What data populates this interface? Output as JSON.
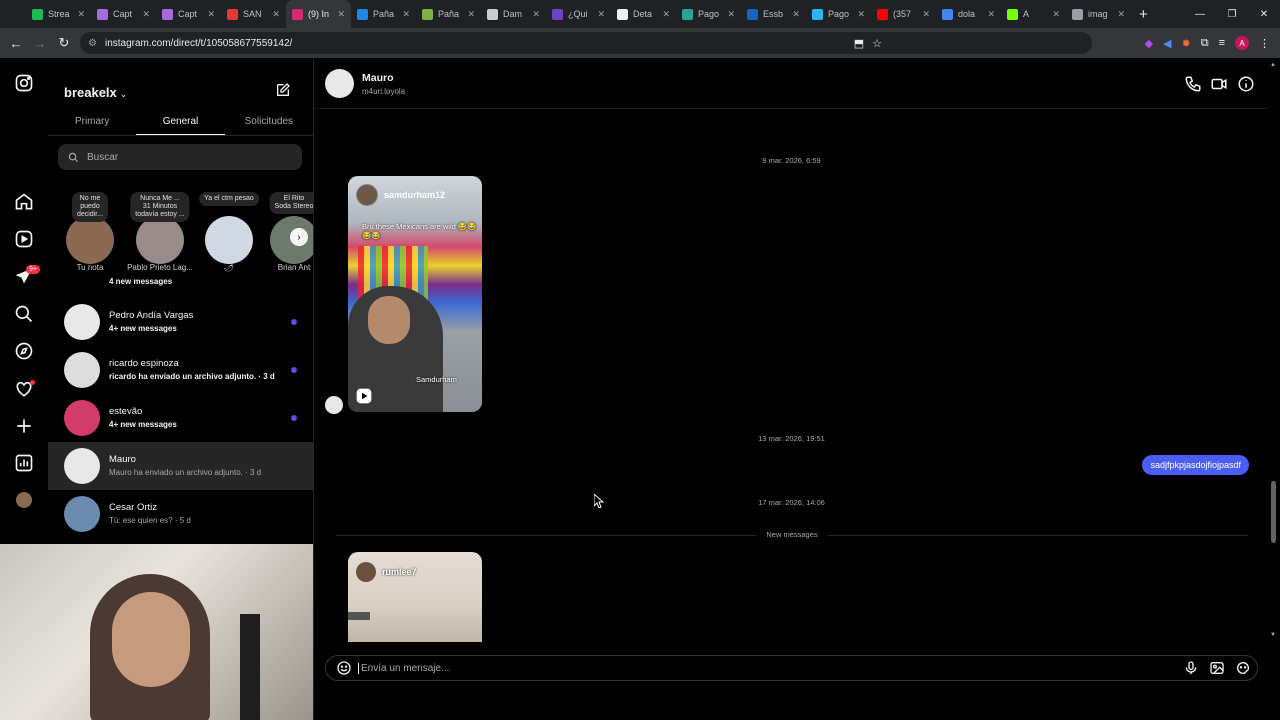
{
  "browser": {
    "tabs": [
      {
        "title": "Strea",
        "color": "#1db954"
      },
      {
        "title": "Capt",
        "color": "#a56bdc"
      },
      {
        "title": "Capt",
        "color": "#a56bdc"
      },
      {
        "title": "SAN",
        "color": "#e53935"
      },
      {
        "title": "(9) In",
        "color": "#d62976"
      },
      {
        "title": "Paña",
        "color": "#1e88e5"
      },
      {
        "title": "Paña",
        "color": "#7cb342"
      },
      {
        "title": "Dam",
        "color": "#cccccc"
      },
      {
        "title": "¿Qui",
        "color": "#6f42c1"
      },
      {
        "title": "Deta",
        "color": "#eeeeee"
      },
      {
        "title": "Pago",
        "color": "#26a69a"
      },
      {
        "title": "Essb",
        "color": "#1565c0"
      },
      {
        "title": "Pago",
        "color": "#29b6f6"
      },
      {
        "title": "(357",
        "color": "#ff0000"
      },
      {
        "title": "dola",
        "color": "#4285f4"
      },
      {
        "title": "A",
        "color": "#76ff03"
      },
      {
        "title": "imag",
        "color": "#9aa0a6"
      }
    ],
    "url": "instagram.com/direct/t/105058677559142/",
    "profile_initial": "A"
  },
  "sidebar": {
    "username": "breakelx",
    "tabs": [
      "Primary",
      "General",
      "Solicitudes"
    ],
    "selected_tab": "General",
    "search_placeholder": "Buscar",
    "notification_badge": "9+",
    "notes": [
      {
        "bubble": "No me\npuedo\ndecidir...",
        "label": "Tu nota",
        "avatar": "#8a6a55"
      },
      {
        "bubble": "Nunca Me ...\n31 Minutos\ntodavía estoy ...",
        "label": "Pablo Prieto Lag...",
        "avatar": "#9a8a8a"
      },
      {
        "bubble": "Ya el ctm pesao",
        "label": "🌶",
        "avatar": "#cfd8e3"
      },
      {
        "bubble": "El Rito\nSoda Stereo",
        "label": "Brian Ant",
        "avatar": "#6b7a6a"
      }
    ],
    "conversations": [
      {
        "name": "",
        "sub": "4 new messages",
        "bold": true,
        "unread": false
      },
      {
        "name": "Pedro Andía Vargas",
        "sub": "4+ new messages",
        "bold": true,
        "unread": true
      },
      {
        "name": "ricardo espinoza",
        "sub": "ricardo ha enviado un archivo adjunto. · 3 d",
        "bold": true,
        "unread": true
      },
      {
        "name": "estevão",
        "sub": "4+ new messages",
        "bold": true,
        "unread": true
      },
      {
        "name": "Mauro",
        "sub": "Mauro ha enviado un archivo adjunto. · 3 d",
        "bold": false,
        "unread": false
      },
      {
        "name": "Cesar Ortiz",
        "sub": "Tú: ese quien es? · 5 d",
        "bold": false,
        "unread": false
      }
    ]
  },
  "chat": {
    "name": "Mauro",
    "handle": "m4uri.loyola",
    "timestamps": [
      "9 mar. 2026, 6:59",
      "13 mar. 2026, 19:51",
      "17 mar. 2026, 14:06"
    ],
    "reel1": {
      "user": "samdurham12",
      "caption": "Bru these Mexicans are wild 😂😂😂😂",
      "watermark": "Samdurham"
    },
    "my_message": "sadjfpkpjasdojfiojpasdf",
    "new_messages_label": "New messages",
    "reel2": {
      "user": "rumlee7"
    },
    "composer_placeholder": "Envía un mensaje..."
  }
}
